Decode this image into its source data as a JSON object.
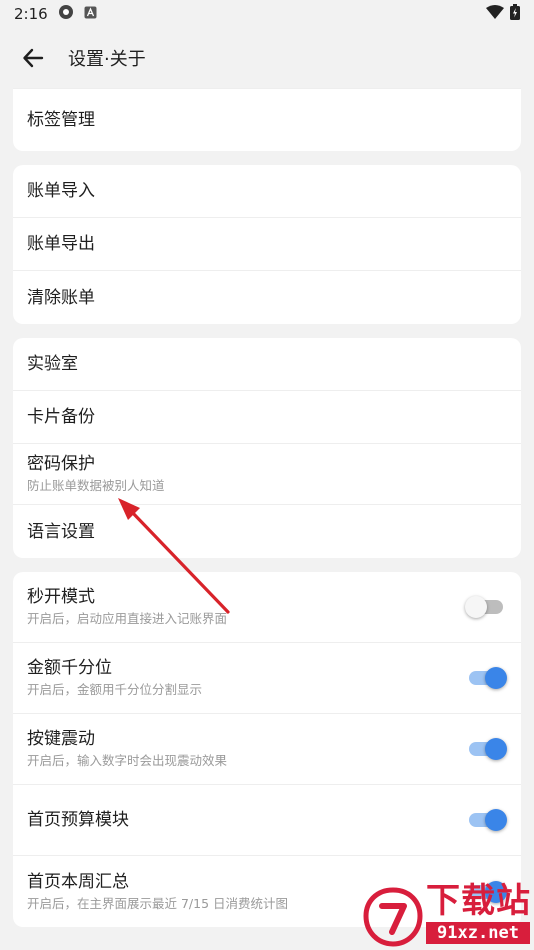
{
  "status_bar": {
    "time": "2:16"
  },
  "header": {
    "title": "设置·关于"
  },
  "groups": [
    {
      "items": [
        {
          "title": "标签管理"
        }
      ]
    },
    {
      "items": [
        {
          "title": "账单导入"
        },
        {
          "title": "账单导出"
        },
        {
          "title": "清除账单"
        }
      ]
    },
    {
      "items": [
        {
          "title": "实验室"
        },
        {
          "title": "卡片备份"
        },
        {
          "title": "密码保护",
          "subtitle": "防止账单数据被别人知道"
        },
        {
          "title": "语言设置"
        }
      ]
    },
    {
      "items": [
        {
          "title": "秒开模式",
          "subtitle": "开启后，启动应用直接进入记账界面",
          "toggle": false
        },
        {
          "title": "金额千分位",
          "subtitle": "开启后，金额用千分位分割显示",
          "toggle": true
        },
        {
          "title": "按键震动",
          "subtitle": "开启后，输入数字时会出现震动效果",
          "toggle": true
        },
        {
          "title": "首页预算模块",
          "toggle": true
        },
        {
          "title": "首页本周汇总",
          "subtitle": "开启后，在主界面展示最近 7/15 日消费统计图",
          "toggle": true
        }
      ]
    }
  ],
  "watermark": {
    "brand": "下载站",
    "url": "91xz.net"
  },
  "colors": {
    "accent": "#3a85e8",
    "arrow": "#d8232a",
    "watermark": "#d81e3c"
  }
}
